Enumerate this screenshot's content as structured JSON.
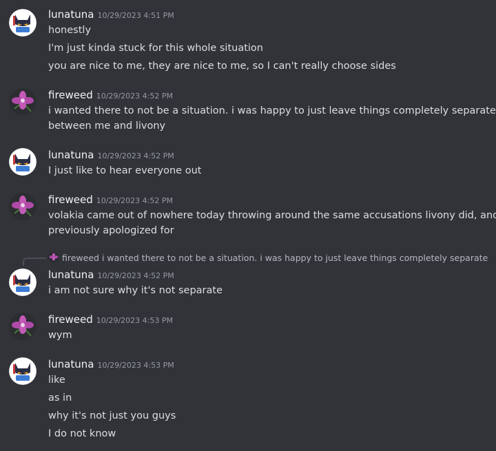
{
  "messages": [
    {
      "user": "lunatuna",
      "avatar": "cat-avatar",
      "time": "10/29/2023 4:51 PM",
      "lines": [
        "honestly",
        "I'm just kinda stuck for this whole situation",
        "you are nice to me, they are nice to me, so I can't really choose sides"
      ]
    },
    {
      "user": "fireweed",
      "avatar": "flower-avatar",
      "time": "10/29/2023 4:52 PM",
      "lines": [
        "i wanted there to not be a situation. i was happy to just leave things completely separate",
        "between me and livony"
      ]
    },
    {
      "user": "lunatuna",
      "avatar": "cat-avatar",
      "time": "10/29/2023 4:52 PM",
      "lines": [
        "I just like to hear everyone out"
      ]
    },
    {
      "user": "fireweed",
      "avatar": "flower-avatar",
      "time": "10/29/2023 4:52 PM",
      "lines": [
        "volakia came out of nowhere today throwing around the same accusations livony did, and",
        "previously apologized for"
      ]
    },
    {
      "user": "lunatuna",
      "avatar": "cat-avatar",
      "time": "10/29/2023 4:52 PM",
      "reply": {
        "user": "fireweed",
        "text": "i wanted there to not be a situation. i was happy to just leave things completely separate betw"
      },
      "lines": [
        "i am not sure why it's not separate"
      ]
    },
    {
      "user": "fireweed",
      "avatar": "flower-avatar",
      "time": "10/29/2023 4:53 PM",
      "lines": [
        "wym"
      ]
    },
    {
      "user": "lunatuna",
      "avatar": "cat-avatar",
      "time": "10/29/2023 4:53 PM",
      "lines": [
        "like",
        "as in",
        "why it's not just you guys",
        "I do not know"
      ]
    }
  ],
  "colors": {
    "background": "#313338",
    "username": "#f2f3f5",
    "timestamp": "#949ba4",
    "text": "#dbdee1"
  }
}
